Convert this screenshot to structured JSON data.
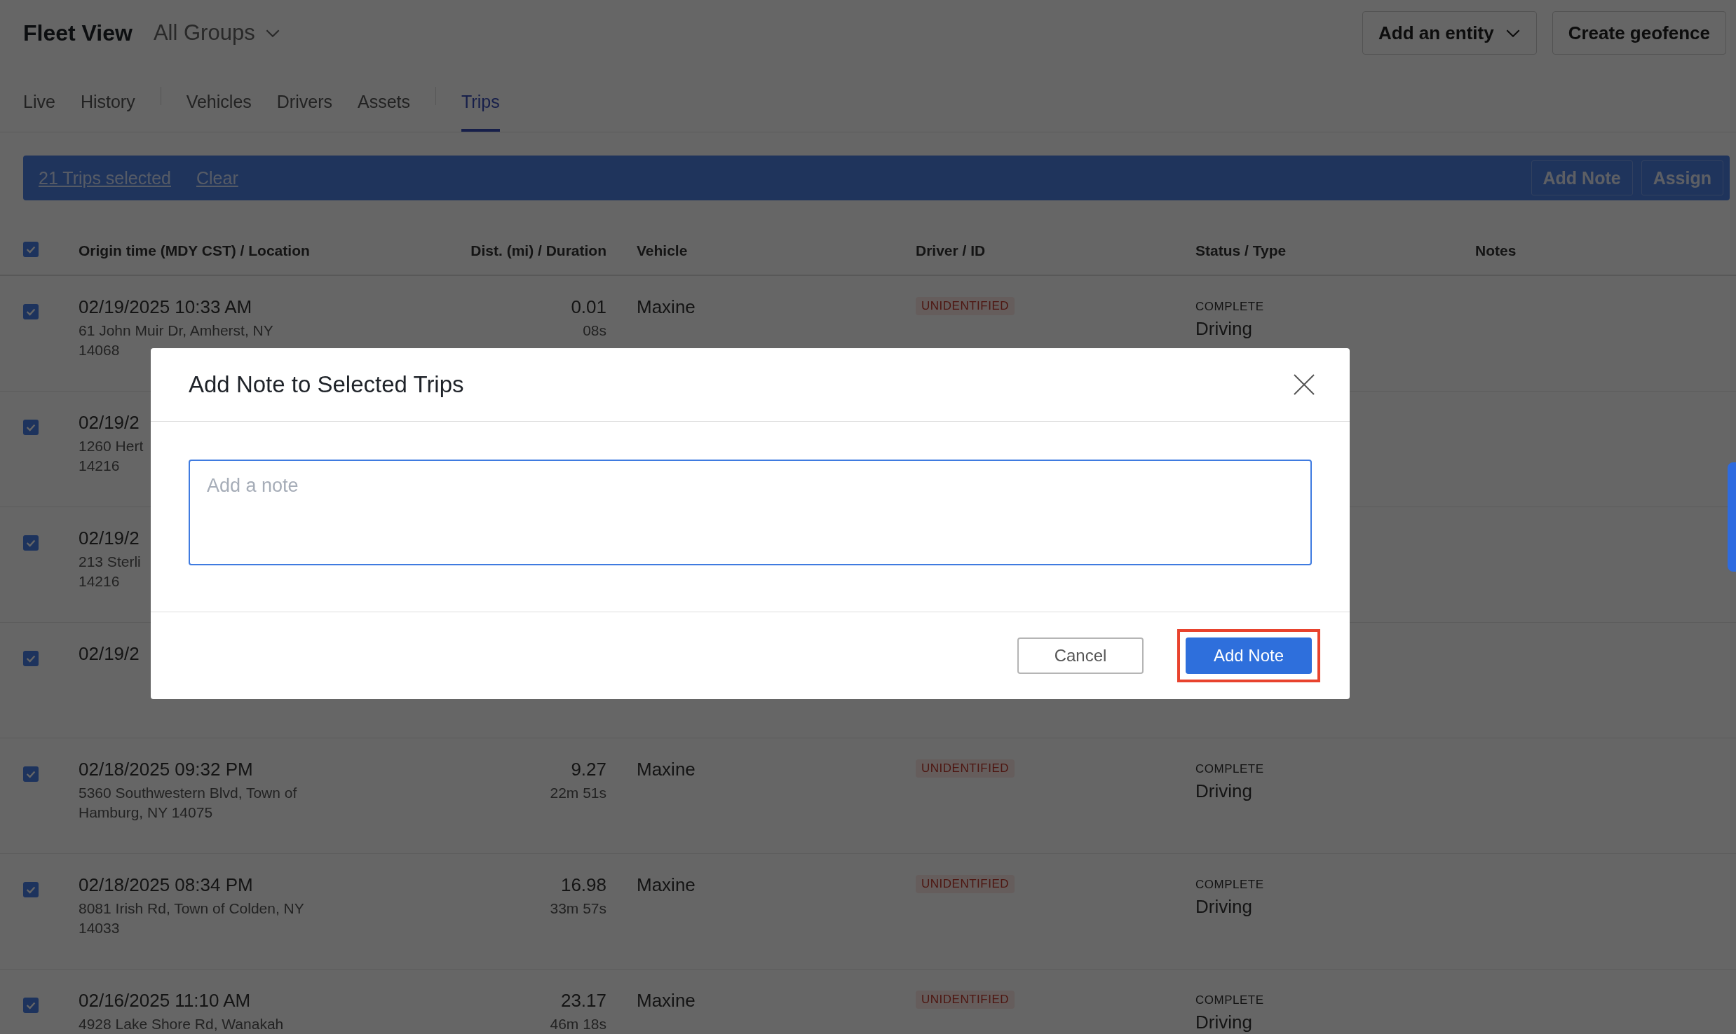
{
  "header": {
    "title": "Fleet View",
    "group_selector": "All Groups",
    "buttons": [
      {
        "label": "Add an entity",
        "kind": "dropdown"
      },
      {
        "label": "Create geofence",
        "kind": "plain"
      }
    ]
  },
  "tab_groups": [
    [
      {
        "label": "Live",
        "selected": false
      },
      {
        "label": "History",
        "selected": false
      }
    ],
    [
      {
        "label": "Vehicles",
        "selected": false
      },
      {
        "label": "Drivers",
        "selected": false
      },
      {
        "label": "Assets",
        "selected": false
      }
    ],
    [
      {
        "label": "Trips",
        "selected": true
      }
    ]
  ],
  "selection_bar": {
    "count": "21 Trips selected",
    "clear": "Clear",
    "actions": [
      "Add Note",
      "Assign"
    ]
  },
  "table": {
    "all_checked": true,
    "columns": [
      "Origin time (MDY CST) / Location",
      "Dist. (mi) / Duration",
      "Vehicle",
      "Driver / ID",
      "Status / Type",
      "Notes"
    ],
    "rows": [
      {
        "checked": true,
        "origin_time": "02/19/2025 10:33 AM",
        "location_lines": [
          "61 John Muir Dr, Amherst, NY",
          "14068"
        ],
        "distance": "0.01",
        "duration": "08s",
        "vehicle": "Maxine",
        "driver": "UNIDENTIFIED",
        "status": "COMPLETE",
        "type": "Driving"
      },
      {
        "checked": true,
        "origin_time": "02/19/2",
        "location_lines": [
          "1260 Hert",
          "14216"
        ]
      },
      {
        "checked": true,
        "origin_time": "02/19/2",
        "location_lines": [
          "213 Sterli",
          "14216"
        ]
      },
      {
        "checked": true,
        "origin_time": "02/19/2"
      },
      {
        "checked": true,
        "origin_time": "02/18/2025 09:32 PM",
        "location_lines": [
          "5360 Southwestern Blvd, Town of",
          "Hamburg, NY 14075"
        ],
        "distance": "9.27",
        "duration": "22m 51s",
        "vehicle": "Maxine",
        "driver": "UNIDENTIFIED",
        "status": "COMPLETE",
        "type": "Driving"
      },
      {
        "checked": true,
        "origin_time": "02/18/2025 08:34 PM",
        "location_lines": [
          "8081 Irish Rd, Town of Colden, NY",
          "14033"
        ],
        "distance": "16.98",
        "duration": "33m 57s",
        "vehicle": "Maxine",
        "driver": "UNIDENTIFIED",
        "status": "COMPLETE",
        "type": "Driving"
      },
      {
        "checked": true,
        "origin_time": "02/16/2025 11:10 AM",
        "location_lines": [
          "4928 Lake Shore Rd, Wanakah"
        ],
        "distance": "23.17",
        "duration": "46m 18s",
        "vehicle": "Maxine",
        "driver": "UNIDENTIFIED",
        "status": "COMPLETE",
        "type": "Driving"
      }
    ]
  },
  "dialog": {
    "title": "Add Note to Selected Trips",
    "note": {
      "placeholder": "Add a note"
    },
    "buttons": [
      {
        "label": "Cancel",
        "kind": "secondary",
        "highlighted": false
      },
      {
        "label": "Add Note",
        "kind": "primary",
        "highlighted": true
      }
    ]
  }
}
